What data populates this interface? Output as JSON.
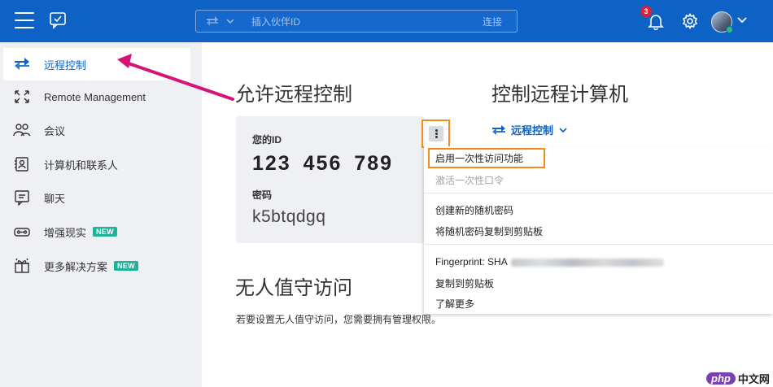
{
  "topbar": {
    "search_placeholder": "插入伙伴ID",
    "connect_label": "连接",
    "notification_count": "3"
  },
  "sidebar": {
    "items": [
      {
        "label": "远程控制",
        "icon": "arrows-exchange-icon",
        "active": true
      },
      {
        "label": "Remote Management",
        "icon": "expand-icon"
      },
      {
        "label": "会议",
        "icon": "people-icon"
      },
      {
        "label": "计算机和联系人",
        "icon": "contact-card-icon"
      },
      {
        "label": "聊天",
        "icon": "chat-icon"
      },
      {
        "label": "增强现实",
        "icon": "ar-glasses-icon",
        "badge": "NEW"
      },
      {
        "label": "更多解决方案",
        "icon": "gift-icon",
        "badge": "NEW"
      }
    ]
  },
  "allow": {
    "heading": "允许远程控制",
    "id_label": "您的ID",
    "id_value": "123 456 789",
    "password_label": "密码",
    "password_value": "k5btqdgq"
  },
  "control": {
    "heading": "控制远程计算机",
    "mode_label": "远程控制"
  },
  "menu": {
    "items": [
      {
        "label": "启用一次性访问功能",
        "enabled": true
      },
      {
        "label": "激活一次性口令",
        "enabled": false
      },
      {
        "label": "创建新的随机密码",
        "enabled": true
      },
      {
        "label": "将随机密码复制到剪贴板",
        "enabled": true
      },
      {
        "label": "Fingerprint: SHA",
        "enabled": true
      },
      {
        "label": "复制到剪贴板",
        "enabled": true
      },
      {
        "label": "了解更多",
        "enabled": true
      }
    ]
  },
  "unattended": {
    "heading": "无人值守访问",
    "text": "若要设置无人值守访问，您需要拥有管理权限。"
  },
  "watermark": {
    "logo": "php",
    "text": "中文网"
  },
  "colors": {
    "brand_blue": "#0e62c6",
    "highlight_orange": "#f08c1c",
    "annotation_arrow": "#d4147a",
    "new_badge": "#1fb39a"
  }
}
